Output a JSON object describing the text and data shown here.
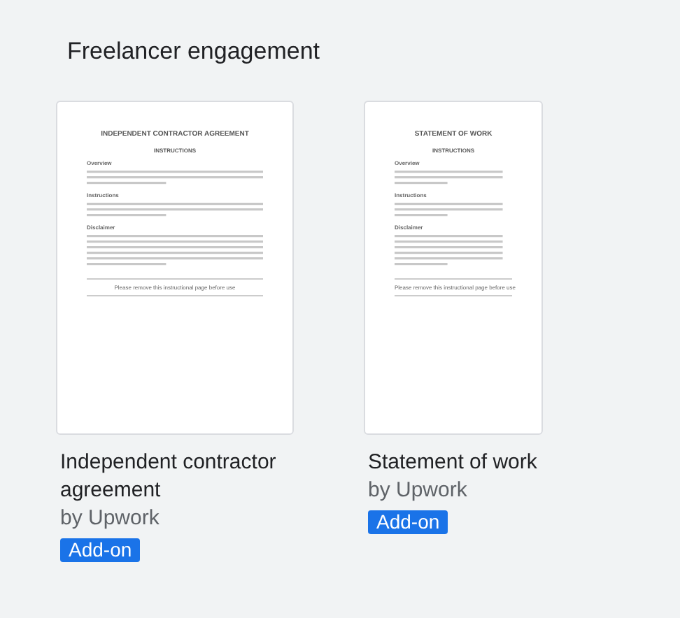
{
  "section_title": "Freelancer engagement",
  "templates": [
    {
      "title": "Independent contractor agreement",
      "author": "by Upwork",
      "badge": "Add-on",
      "doc": {
        "heading": "INDEPENDENT CONTRACTOR AGREEMENT",
        "subheading": "INSTRUCTIONS",
        "sections": [
          "Overview",
          "Instructions",
          "Disclaimer"
        ],
        "footer": "Please remove this instructional page before use"
      }
    },
    {
      "title": "Statement of work",
      "author": "by Upwork",
      "badge": "Add-on",
      "doc": {
        "heading": "STATEMENT OF WORK",
        "subheading": "INSTRUCTIONS",
        "sections": [
          "Overview",
          "Instructions",
          "Disclaimer"
        ],
        "footer": "Please remove this instructional page before use"
      }
    }
  ]
}
